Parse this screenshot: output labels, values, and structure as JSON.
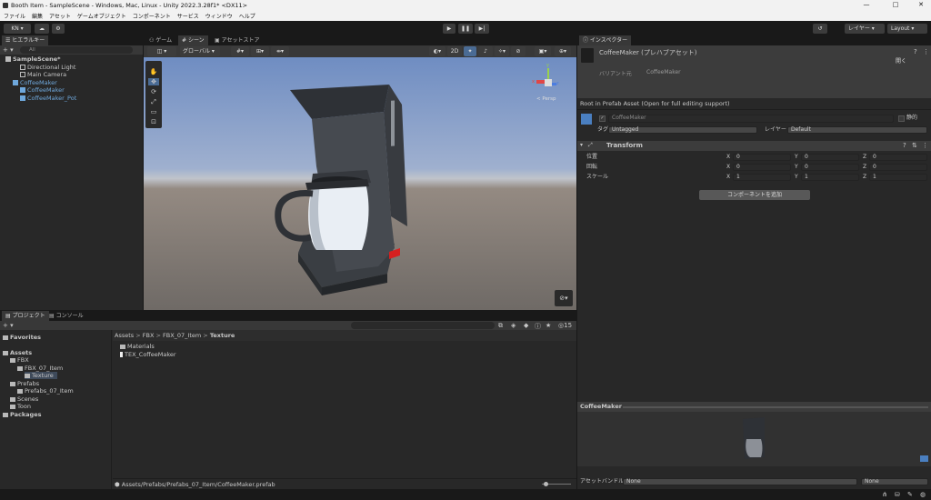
{
  "window": {
    "title": "Booth Item - SampleScene - Windows, Mac, Linux - Unity 2022.3.28f1* <DX11>",
    "minimize": "—",
    "maximize": "□",
    "close": "✕"
  },
  "menu": [
    "ファイル",
    "編集",
    "アセット",
    "ゲームオブジェクト",
    "コンポーネント",
    "サービス",
    "ウィンドウ",
    "ヘルプ"
  ],
  "toolbar": {
    "account": "KN",
    "layers": "レイヤー",
    "layout": "Layout",
    "play": "▶",
    "pause": "❚❚",
    "step": "▶|"
  },
  "hierarchy": {
    "tab": "ヒエラルキー",
    "search_placeholder": "All",
    "add": "+ ▾",
    "items": [
      {
        "label": "SampleScene*",
        "indent": 0,
        "type": "scene"
      },
      {
        "label": "Directional Light",
        "indent": 2,
        "type": "obj"
      },
      {
        "label": "Main Camera",
        "indent": 2,
        "type": "obj"
      },
      {
        "label": "CoffeeMaker",
        "indent": 1,
        "type": "prefab"
      },
      {
        "label": "CoffeeMaker",
        "indent": 2,
        "type": "prefab"
      },
      {
        "label": "CoffeeMaker_Pot",
        "indent": 2,
        "type": "prefab"
      }
    ]
  },
  "scene": {
    "tabs": [
      "ゲーム",
      "シーン",
      "アセットストア"
    ],
    "global": "グローバル",
    "twoD": "2D",
    "persp": "< Persp",
    "axis_x": "x",
    "axis_y": "y",
    "axis_z": "z"
  },
  "inspector": {
    "tab": "インスペクター",
    "asset_name": "CoffeeMaker (プレハブアセット)",
    "open_btn": "開く",
    "variant_label": "バリアント元",
    "variant_value": "CoffeeMaker",
    "root_note": "Root in Prefab Asset (Open for full editing support)",
    "object_name": "CoffeeMaker",
    "static": "静的",
    "tag_label": "タグ",
    "tag_value": "Untagged",
    "layer_label": "レイヤー",
    "layer_value": "Default",
    "transform": "Transform",
    "position_label": "位置",
    "rotation_label": "回転",
    "scale_label": "スケール",
    "position": [
      "0",
      "0",
      "0"
    ],
    "rotation": [
      "0",
      "0",
      "0"
    ],
    "scale": [
      "1",
      "1",
      "1"
    ],
    "add_component": "コンポーネントを追加",
    "preview_title": "CoffeeMaker",
    "assetbundle_label": "アセットバンドル",
    "assetbundle_value": "None",
    "assetbundle_variant": "None"
  },
  "project": {
    "tabs": [
      "プロジェクト",
      "コンソール"
    ],
    "count": "15",
    "tree": [
      {
        "label": "Favorites",
        "indent": 0,
        "bold": true
      },
      {
        "label": "Assets",
        "indent": 0,
        "bold": true
      },
      {
        "label": "FBX",
        "indent": 1,
        "bold": false
      },
      {
        "label": "FBX_07_Item",
        "indent": 2,
        "bold": false
      },
      {
        "label": "Texture",
        "indent": 3,
        "bold": false
      },
      {
        "label": "Prefabs",
        "indent": 1,
        "bold": false
      },
      {
        "label": "Prefabs_07_Item",
        "indent": 2,
        "bold": false
      },
      {
        "label": "Scenes",
        "indent": 1,
        "bold": false
      },
      {
        "label": "Toon",
        "indent": 1,
        "bold": false
      },
      {
        "label": "Packages",
        "indent": 0,
        "bold": true
      }
    ],
    "breadcrumb": [
      "Assets",
      "FBX",
      "FBX_07_Item",
      "Texture"
    ],
    "files": [
      {
        "label": "Materials",
        "type": "folder"
      },
      {
        "label": "TEX_CoffeeMaker",
        "type": "image"
      }
    ],
    "status_path": "Assets/Prefabs/Prefabs_07_Item/CoffeeMaker.prefab"
  }
}
